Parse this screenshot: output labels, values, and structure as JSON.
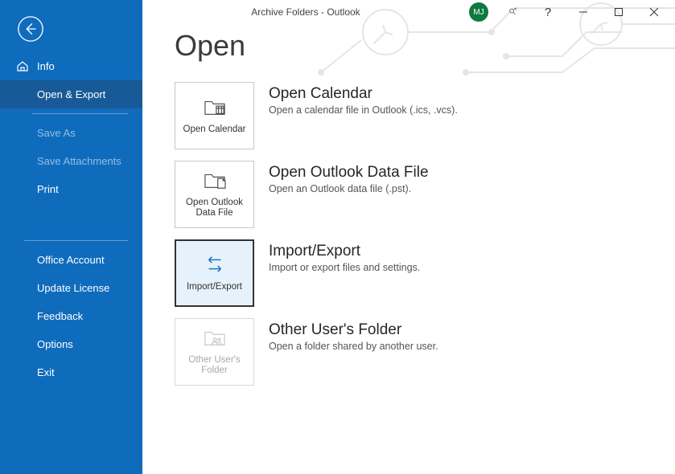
{
  "window": {
    "title": "Archive Folders  -  Outlook",
    "avatar_initials": "MJ"
  },
  "sidebar": {
    "info": "Info",
    "open_export": "Open & Export",
    "save_as": "Save As",
    "save_attachments": "Save Attachments",
    "print": "Print",
    "office_account": "Office Account",
    "update_license": "Update License",
    "feedback": "Feedback",
    "options": "Options",
    "exit": "Exit"
  },
  "page": {
    "title": "Open"
  },
  "tiles": {
    "open_calendar": {
      "button_label": "Open Calendar",
      "title": "Open Calendar",
      "desc": "Open a calendar file in Outlook (.ics, .vcs)."
    },
    "open_data_file": {
      "button_label": "Open Outlook Data File",
      "title": "Open Outlook Data File",
      "desc": "Open an Outlook data file (.pst)."
    },
    "import_export": {
      "button_label": "Import/Export",
      "title": "Import/Export",
      "desc": "Import or export files and settings."
    },
    "other_user": {
      "button_label": "Other User's Folder",
      "title": "Other User's Folder",
      "desc": "Open a folder shared by another user."
    }
  }
}
